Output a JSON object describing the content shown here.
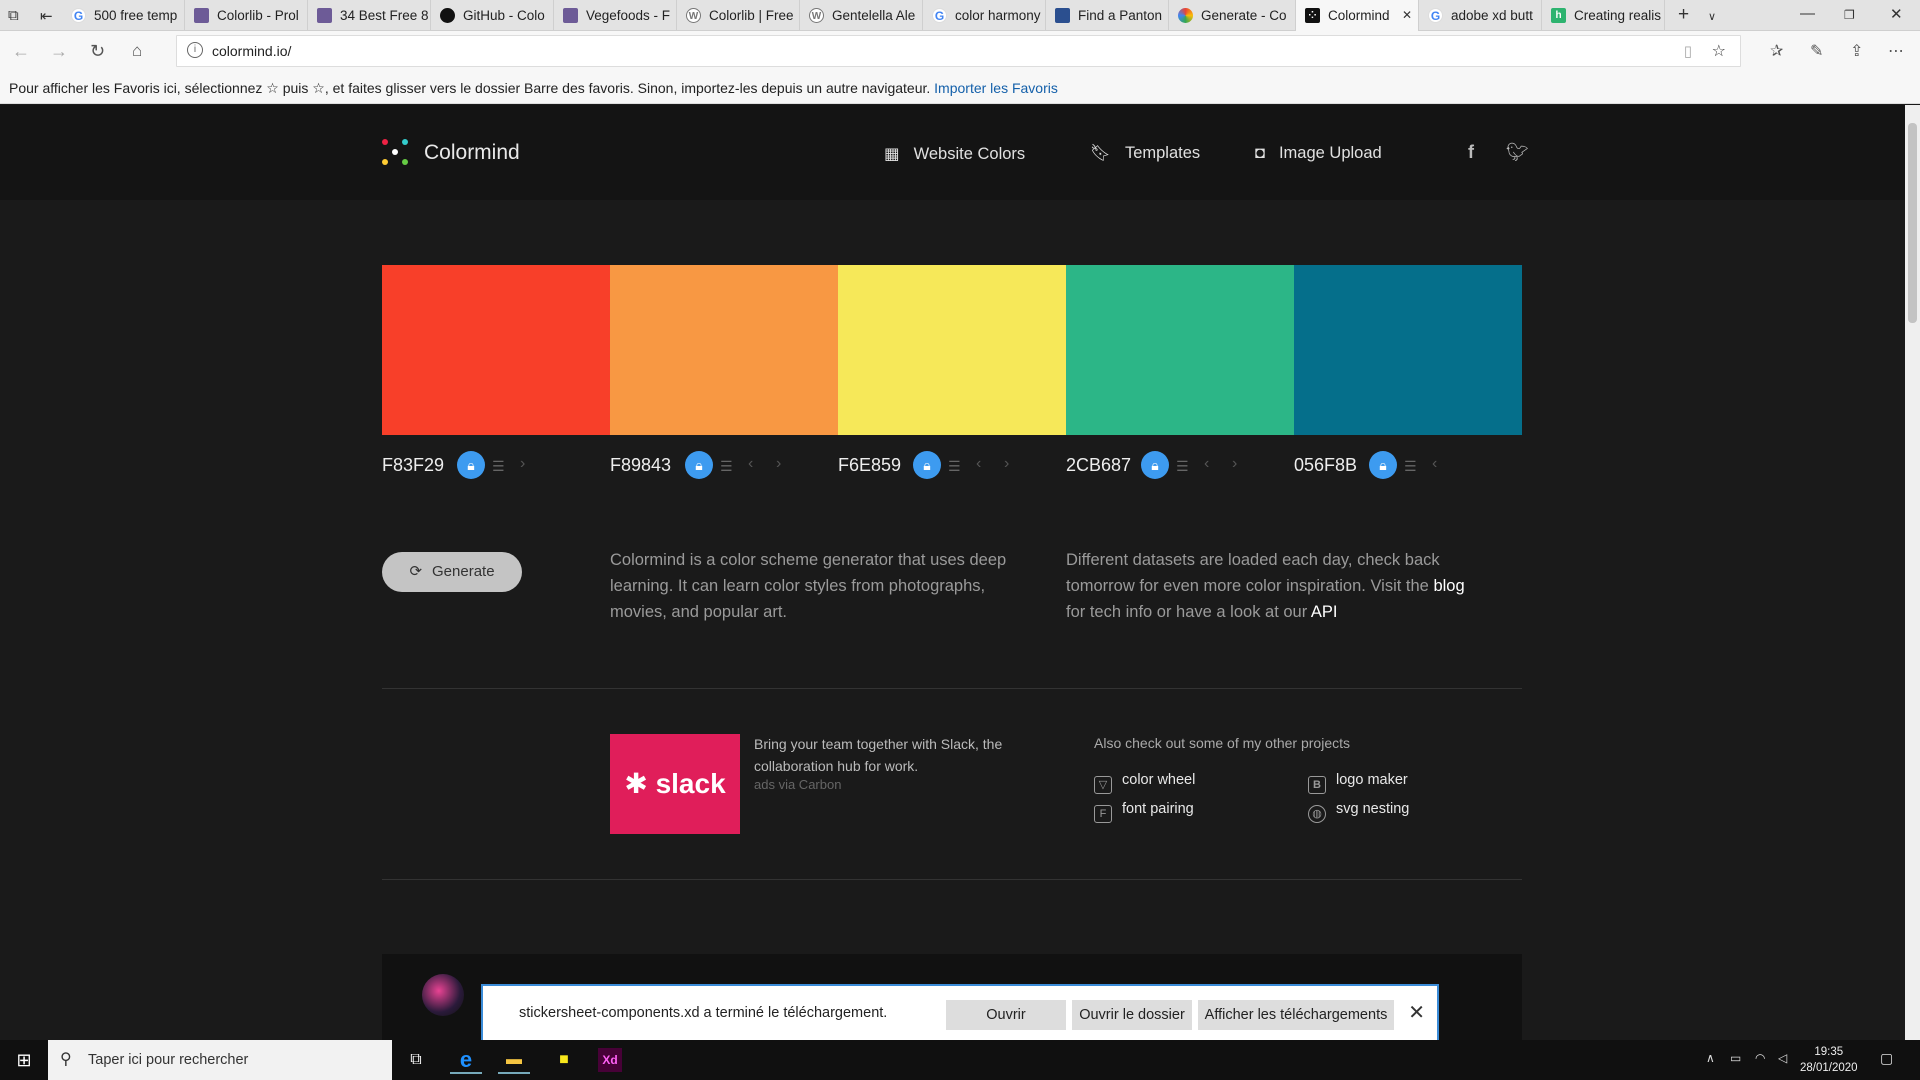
{
  "browser": {
    "tabs": [
      {
        "title": "500 free temp",
        "fav": "g",
        "glyph": "G"
      },
      {
        "title": "Colorlib - Prol",
        "fav": "c",
        "glyph": ""
      },
      {
        "title": "34 Best Free 8",
        "fav": "c",
        "glyph": ""
      },
      {
        "title": "GitHub - Colo",
        "fav": "gh",
        "glyph": ""
      },
      {
        "title": "Vegefoods - F",
        "fav": "c",
        "glyph": ""
      },
      {
        "title": "Colorlib | Free",
        "fav": "wp",
        "glyph": "W"
      },
      {
        "title": "Gentelella Ale",
        "fav": "wp",
        "glyph": "W"
      },
      {
        "title": "color harmony",
        "fav": "g",
        "glyph": "G"
      },
      {
        "title": "Find a Panton",
        "fav": "p",
        "glyph": ""
      },
      {
        "title": "Generate - Co",
        "fav": "gc",
        "glyph": ""
      },
      {
        "title": "Colormind",
        "fav": "cm",
        "glyph": "⁘",
        "active": true
      },
      {
        "title": "adobe xd butt",
        "fav": "g",
        "glyph": "G"
      },
      {
        "title": "Creating realis",
        "fav": "h",
        "glyph": "h"
      }
    ],
    "url": "colormind.io/",
    "favorites_bar": {
      "text": "Pour afficher les Favoris ici, sélectionnez ☆ puis ☆, et faites glisser vers le dossier Barre des favoris. Sinon, importez-les depuis un autre navigateur.",
      "link": "Importer les Favoris"
    }
  },
  "site": {
    "brand": "Colormind",
    "nav": [
      {
        "label": "Website Colors",
        "icon": "grid-icon"
      },
      {
        "label": "Templates",
        "icon": "bookmark-icon"
      },
      {
        "label": "Image Upload",
        "icon": "camera-icon"
      }
    ],
    "social": [
      "facebook-icon",
      "twitter-icon"
    ],
    "palette": [
      {
        "hex": "F83F29",
        "color": "#F83F29"
      },
      {
        "hex": "F89843",
        "color": "#F89843"
      },
      {
        "hex": "F6E859",
        "color": "#F6E859"
      },
      {
        "hex": "2CB687",
        "color": "#2CB687"
      },
      {
        "hex": "056F8B",
        "color": "#056F8B"
      }
    ],
    "generate_label": "Generate",
    "intro": "Colormind is a color scheme generator that uses deep learning. It can learn color styles from photographs, movies, and popular art.",
    "datasets": {
      "text1": "Different datasets are loaded each day, check back tomorrow for even more color inspiration. Visit the",
      "blog": "blog",
      "text2": "for tech info or have a look at our",
      "api": "API"
    },
    "ad": {
      "logo": "slack",
      "text": "Bring your team together with Slack, the collaboration hub for work.",
      "via": "ads via Carbon"
    },
    "other_projects": {
      "heading": "Also check out some of my other projects",
      "items": [
        {
          "label": "color wheel",
          "icon": "color-wheel-icon"
        },
        {
          "label": "logo maker",
          "icon": "logo-maker-icon"
        },
        {
          "label": "font pairing",
          "icon": "font-pairing-icon"
        },
        {
          "label": "svg nesting",
          "icon": "svg-nesting-icon"
        }
      ]
    }
  },
  "download_bar": {
    "message": "stickersheet-components.xd a terminé le téléchargement.",
    "open": "Ouvrir",
    "open_folder": "Ouvrir le dossier",
    "show_downloads": "Afficher les téléchargements"
  },
  "taskbar": {
    "search_placeholder": "Taper ici pour rechercher",
    "time": "19:35",
    "date": "28/01/2020"
  }
}
